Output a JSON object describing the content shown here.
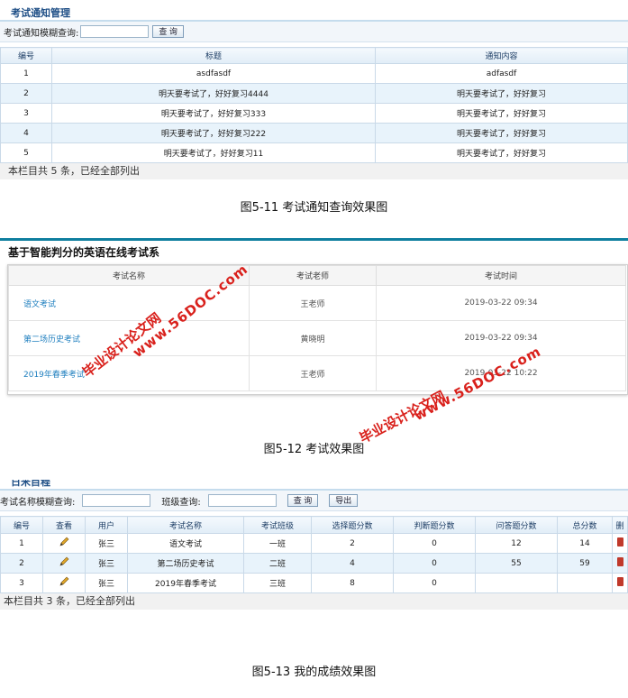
{
  "notices": {
    "title": "考试通知管理",
    "search_label": "考试通知模糊查询:",
    "search_button": "查 询",
    "columns": [
      "编号",
      "标题",
      "通知内容"
    ],
    "rows": [
      {
        "id": "1",
        "title": "asdfasdf",
        "content": "adfasdf"
      },
      {
        "id": "2",
        "title": "明天要考试了，好好复习4444",
        "content": "明天要考试了，好好复习"
      },
      {
        "id": "3",
        "title": "明天要考试了，好好复习333",
        "content": "明天要考试了，好好复习"
      },
      {
        "id": "4",
        "title": "明天要考试了，好好复习222",
        "content": "明天要考试了，好好复习"
      },
      {
        "id": "5",
        "title": "明天要考试了，好好复习11",
        "content": "明天要考试了，好好复习"
      }
    ],
    "footer": "本栏目共 5 条，已经全部列出"
  },
  "caption1": "图5-11 考试通知查询效果图",
  "exam": {
    "title": "基于智能判分的英语在线考试系",
    "columns": [
      "考试名称",
      "考试老师",
      "考试时间"
    ],
    "rows": [
      {
        "name": "语文考试",
        "teacher": "王老师",
        "time": "2019-03-22 09:34"
      },
      {
        "name": "第二场历史考试",
        "teacher": "黄晓明",
        "time": "2019-03-22 09:34"
      },
      {
        "name": "2019年春季考试",
        "teacher": "王老师",
        "time": "2019-03-22 10:22"
      }
    ]
  },
  "caption2": "图5-12 考试效果图",
  "scores": {
    "title": "日米目程",
    "search_label": "考试名称模糊查询:",
    "class_label": "班级查询:",
    "search_button": "查 询",
    "export_button": "导出",
    "columns": [
      "编号",
      "查看",
      "用户",
      "考试名称",
      "考试班级",
      "选择题分数",
      "判断题分数",
      "问答题分数",
      "总分数",
      "删"
    ],
    "rows": [
      {
        "id": "1",
        "user": "张三",
        "exam": "语文考试",
        "class": "一班",
        "choice": "2",
        "judge": "0",
        "qa": "12",
        "total": "14"
      },
      {
        "id": "2",
        "user": "张三",
        "exam": "第二场历史考试",
        "class": "二班",
        "choice": "4",
        "judge": "0",
        "qa": "55",
        "total": "59"
      },
      {
        "id": "3",
        "user": "张三",
        "exam": "2019年春季考试",
        "class": "三班",
        "choice": "8",
        "judge": "0",
        "qa": "",
        "total": ""
      }
    ],
    "footer": "本栏目共 3 条，已经全部列出"
  },
  "caption3": "图5-13 我的成绩效果图",
  "watermarks": {
    "site": "www.56DOC.com",
    "brand": "毕业设计论文网"
  },
  "colors": {
    "accent": "#1f4f86",
    "link": "#1f7fbf",
    "watermark": "#d9211c",
    "bar": "#0f7f9f"
  }
}
